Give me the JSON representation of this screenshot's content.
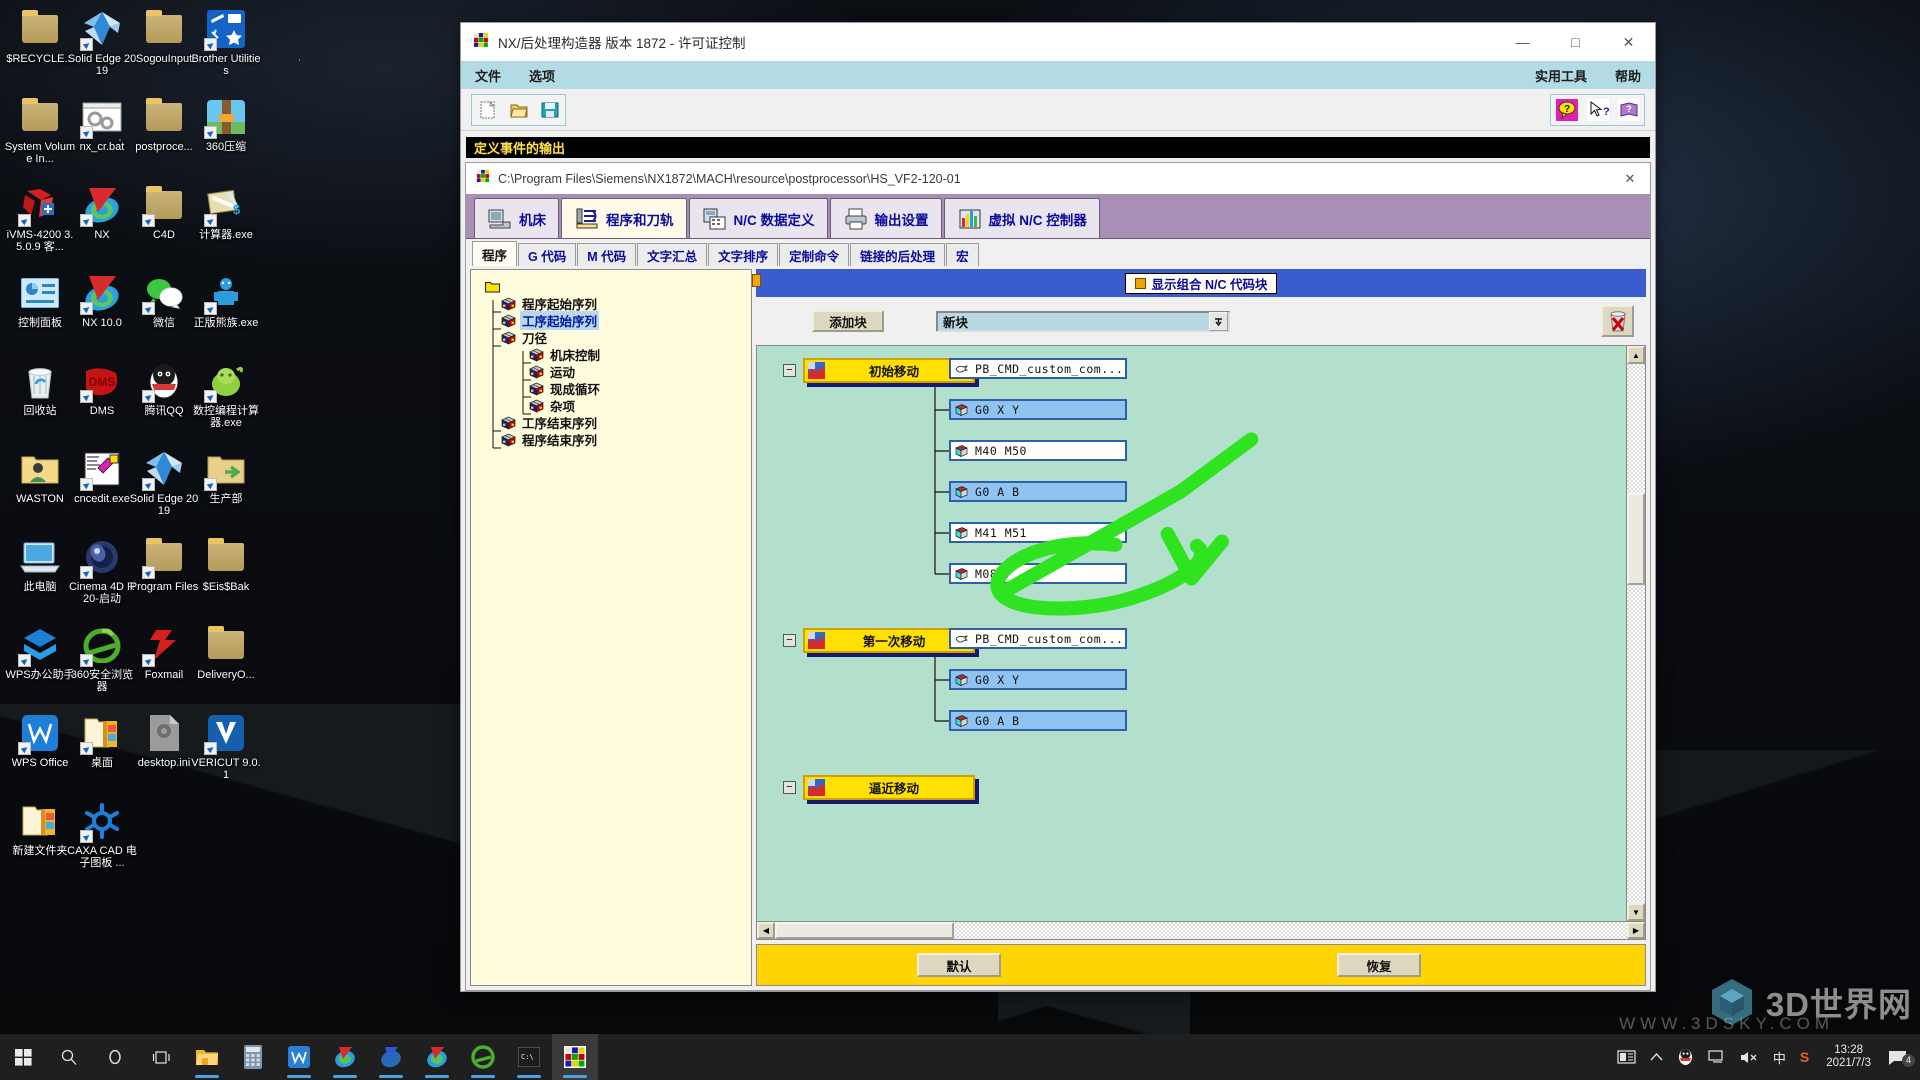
{
  "desktop": {
    "icons": [
      {
        "label": "$RECYCLE...",
        "icon": "folder-icon"
      },
      {
        "label": "Solid Edge 2019",
        "icon": "solid-edge-icon"
      },
      {
        "label": "SogouInput",
        "icon": "folder-icon"
      },
      {
        "label": "Brother Utilities",
        "icon": "brother-utilities-icon"
      },
      {
        "label": "System Volume In...",
        "icon": "folder-icon"
      },
      {
        "label": "nx_cr.bat",
        "icon": "batch-file-icon"
      },
      {
        "label": "postproce...",
        "icon": "folder-icon"
      },
      {
        "label": "360压缩",
        "icon": "360-zip-icon"
      },
      {
        "label": "iVMS-4200 3.5.0.9 客...",
        "icon": "ivms-icon"
      },
      {
        "label": "NX",
        "icon": "nx-icon"
      },
      {
        "label": "C4D",
        "icon": "folder-icon"
      },
      {
        "label": "计算器.exe",
        "icon": "calculator-exe-icon"
      },
      {
        "label": "控制面板",
        "icon": "control-panel-icon"
      },
      {
        "label": "NX 10.0",
        "icon": "nx-icon"
      },
      {
        "label": "微信",
        "icon": "wechat-icon"
      },
      {
        "label": "正版熊族.exe",
        "icon": "bear-icon"
      },
      {
        "label": "回收站",
        "icon": "recycle-bin-icon"
      },
      {
        "label": "DMS",
        "icon": "dms-icon"
      },
      {
        "label": "腾讯QQ",
        "icon": "qq-icon"
      },
      {
        "label": "数控编程计算器.exe",
        "icon": "cnc-calc-icon"
      },
      {
        "label": "WASTON",
        "icon": "user-folder-icon"
      },
      {
        "label": "cncedit.exe",
        "icon": "cncedit-icon"
      },
      {
        "label": "Solid Edge 2019",
        "icon": "solid-edge-icon"
      },
      {
        "label": "生产部",
        "icon": "shared-folder-icon"
      },
      {
        "label": "此电脑",
        "icon": "this-pc-icon"
      },
      {
        "label": "Cinema 4D R20-启动",
        "icon": "cinema4d-icon"
      },
      {
        "label": "Program Files",
        "icon": "folder-icon"
      },
      {
        "label": "$Eis$Bak",
        "icon": "folder-icon"
      },
      {
        "label": "WPS办公助手",
        "icon": "wps-assistant-icon"
      },
      {
        "label": "360安全浏览器",
        "icon": "360-browser-icon"
      },
      {
        "label": "Foxmail",
        "icon": "foxmail-icon"
      },
      {
        "label": "DeliveryO...",
        "icon": "folder-icon"
      },
      {
        "label": "WPS Office",
        "icon": "wps-office-icon"
      },
      {
        "label": "桌面",
        "icon": "desktop-folder-icon"
      },
      {
        "label": "desktop.ini",
        "icon": "ini-file-icon"
      },
      {
        "label": "VERICUT 9.0.1",
        "icon": "vericut-icon"
      },
      {
        "label": "新建文件夹",
        "icon": "desktop-folder-icon"
      },
      {
        "label": "CAXA CAD 电子图板 ...",
        "icon": "caxa-icon"
      }
    ]
  },
  "taskbar": {
    "buttons": [
      {
        "name": "start-button",
        "icon": "windows-logo-icon"
      },
      {
        "name": "search-button",
        "icon": "search-icon"
      },
      {
        "name": "cortana-button",
        "icon": "cortana-circle-icon"
      },
      {
        "name": "task-view-button",
        "icon": "task-view-icon"
      }
    ],
    "apps": [
      {
        "name": "file-explorer",
        "icon": "file-explorer-icon",
        "open": true
      },
      {
        "name": "calculator",
        "icon": "calculator-icon",
        "open": false
      },
      {
        "name": "wps",
        "icon": "wps-icon",
        "open": true
      },
      {
        "name": "nx-1",
        "icon": "nx-icon",
        "open": true
      },
      {
        "name": "nx-blue",
        "icon": "nx-blue-icon",
        "open": true
      },
      {
        "name": "nx-2",
        "icon": "nx-icon",
        "open": true
      },
      {
        "name": "browser-360",
        "icon": "360-browser-icon",
        "open": true
      },
      {
        "name": "console",
        "icon": "console-icon",
        "open": true
      },
      {
        "name": "post-builder",
        "icon": "post-builder-icon",
        "open": true,
        "active": true
      }
    ],
    "tray": [
      {
        "name": "news-icon",
        "glyph": "news"
      },
      {
        "name": "show-hidden-icons-chevron",
        "glyph": "chevron-up"
      },
      {
        "name": "qq-tray-icon",
        "glyph": "qq"
      },
      {
        "name": "network-icon",
        "glyph": "network"
      },
      {
        "name": "volume-icon",
        "glyph": "volume-muted"
      },
      {
        "name": "ime-icon",
        "glyph": "中"
      },
      {
        "name": "sogou-icon",
        "glyph": "S"
      }
    ],
    "clock": {
      "time": "13:28",
      "date": "2021/7/3"
    },
    "action_center": {
      "badge": "4"
    }
  },
  "watermark": {
    "text": "3D世界网",
    "url": "WWW.3DSKY.COM"
  },
  "app": {
    "title": "NX/后处理构造器 版本 1872 - 许可证控制",
    "icon": "post-builder-icon",
    "menus": [
      "文件",
      "选项"
    ],
    "menus_right": [
      "实用工具",
      "帮助"
    ],
    "toolbar": {
      "left": [
        {
          "name": "new-button",
          "icon": "new-document-icon"
        },
        {
          "name": "open-button",
          "icon": "open-folder-icon"
        },
        {
          "name": "save-button",
          "icon": "floppy-save-icon"
        }
      ],
      "right": [
        {
          "name": "help-balloon-button",
          "icon": "help-balloon-icon"
        },
        {
          "name": "whats-this-button",
          "icon": "whats-this-cursor-icon"
        },
        {
          "name": "help-book-button",
          "icon": "help-book-icon"
        }
      ]
    },
    "window_buttons": {
      "minimize": "—",
      "maximize": "□",
      "close": "✕"
    },
    "banner": "定义事件的输出"
  },
  "document": {
    "path": "C:\\Program Files\\Siemens\\NX1872\\MACH\\resource\\postprocessor\\HS_VF2-120-01",
    "icon": "post-builder-icon",
    "close_glyph": "✕",
    "main_tabs": [
      {
        "label": "机床",
        "icon": "machine-tool-icon",
        "active": false
      },
      {
        "label": "程序和刀轨",
        "icon": "program-toolpath-icon",
        "active": true
      },
      {
        "label": "N/C 数据定义",
        "icon": "nc-data-icon",
        "active": false
      },
      {
        "label": "输出设置",
        "icon": "printer-icon",
        "active": false
      },
      {
        "label": "虚拟 N/C 控制器",
        "icon": "virtual-nc-icon",
        "active": false
      }
    ],
    "sub_tabs": [
      {
        "label": "程序",
        "active": true
      },
      {
        "label": "G 代码",
        "active": false
      },
      {
        "label": "M 代码",
        "active": false
      },
      {
        "label": "文字汇总",
        "active": false
      },
      {
        "label": "文字排序",
        "active": false
      },
      {
        "label": "定制命令",
        "active": false
      },
      {
        "label": "链接的后处理",
        "active": false
      },
      {
        "label": "宏",
        "active": false
      }
    ]
  },
  "tree": {
    "root": {
      "icon": "folder-icon"
    },
    "items": [
      {
        "label": "程序起始序列",
        "level": 1,
        "selected": false,
        "icon": "cube-icon"
      },
      {
        "label": "工序起始序列",
        "level": 1,
        "selected": true,
        "icon": "cube-icon"
      },
      {
        "label": "刀径",
        "level": 1,
        "selected": false,
        "icon": "cube-icon"
      },
      {
        "label": "机床控制",
        "level": 2,
        "selected": false,
        "icon": "cube-icon"
      },
      {
        "label": "运动",
        "level": 2,
        "selected": false,
        "icon": "cube-icon"
      },
      {
        "label": "现成循环",
        "level": 2,
        "selected": false,
        "icon": "cube-icon"
      },
      {
        "label": "杂项",
        "level": 2,
        "selected": false,
        "icon": "cube-icon"
      },
      {
        "label": "工序结束序列",
        "level": 1,
        "selected": false,
        "icon": "cube-icon"
      },
      {
        "label": "程序结束序列",
        "level": 1,
        "selected": false,
        "icon": "cube-icon"
      }
    ]
  },
  "editor": {
    "header": {
      "label": "显示组合 N/C 代码块",
      "marker_color": "#f0a500"
    },
    "add_block_label": "添加块",
    "block_combo": {
      "value": "新块",
      "arrow": "⬇"
    },
    "trash": {
      "name": "delete-block-button",
      "icon": "trash-delete-icon"
    },
    "groups": [
      {
        "label": "初始移动",
        "expander": "−",
        "icon": "event-block-icon",
        "leaves": [
          {
            "text": "PB_CMD_custom_com...",
            "style": "white",
            "icon": "custom-command-icon"
          },
          {
            "text": "G0 X Y",
            "style": "blue",
            "icon": "block-cube-icon"
          },
          {
            "text": "M40 M50",
            "style": "white",
            "icon": "block-cube-icon"
          },
          {
            "text": "G0 A B",
            "style": "blue",
            "icon": "block-cube-icon"
          },
          {
            "text": "M41 M51",
            "style": "white",
            "icon": "block-cube-icon"
          },
          {
            "text": "M08",
            "style": "white",
            "icon": "block-cube-icon"
          }
        ]
      },
      {
        "label": "第一次移动",
        "expander": "−",
        "icon": "event-block-icon",
        "leaves": [
          {
            "text": "PB_CMD_custom_com...",
            "style": "white",
            "icon": "custom-command-icon"
          },
          {
            "text": "G0 X Y",
            "style": "blue",
            "icon": "block-cube-icon"
          },
          {
            "text": "G0 A B",
            "style": "blue",
            "icon": "block-cube-icon"
          }
        ]
      },
      {
        "label": "逼近移动",
        "expander": "−",
        "icon": "event-block-icon",
        "leaves": []
      }
    ],
    "actions": [
      {
        "label": "默认",
        "name": "default-button"
      },
      {
        "label": "恢复",
        "name": "restore-button"
      }
    ]
  }
}
